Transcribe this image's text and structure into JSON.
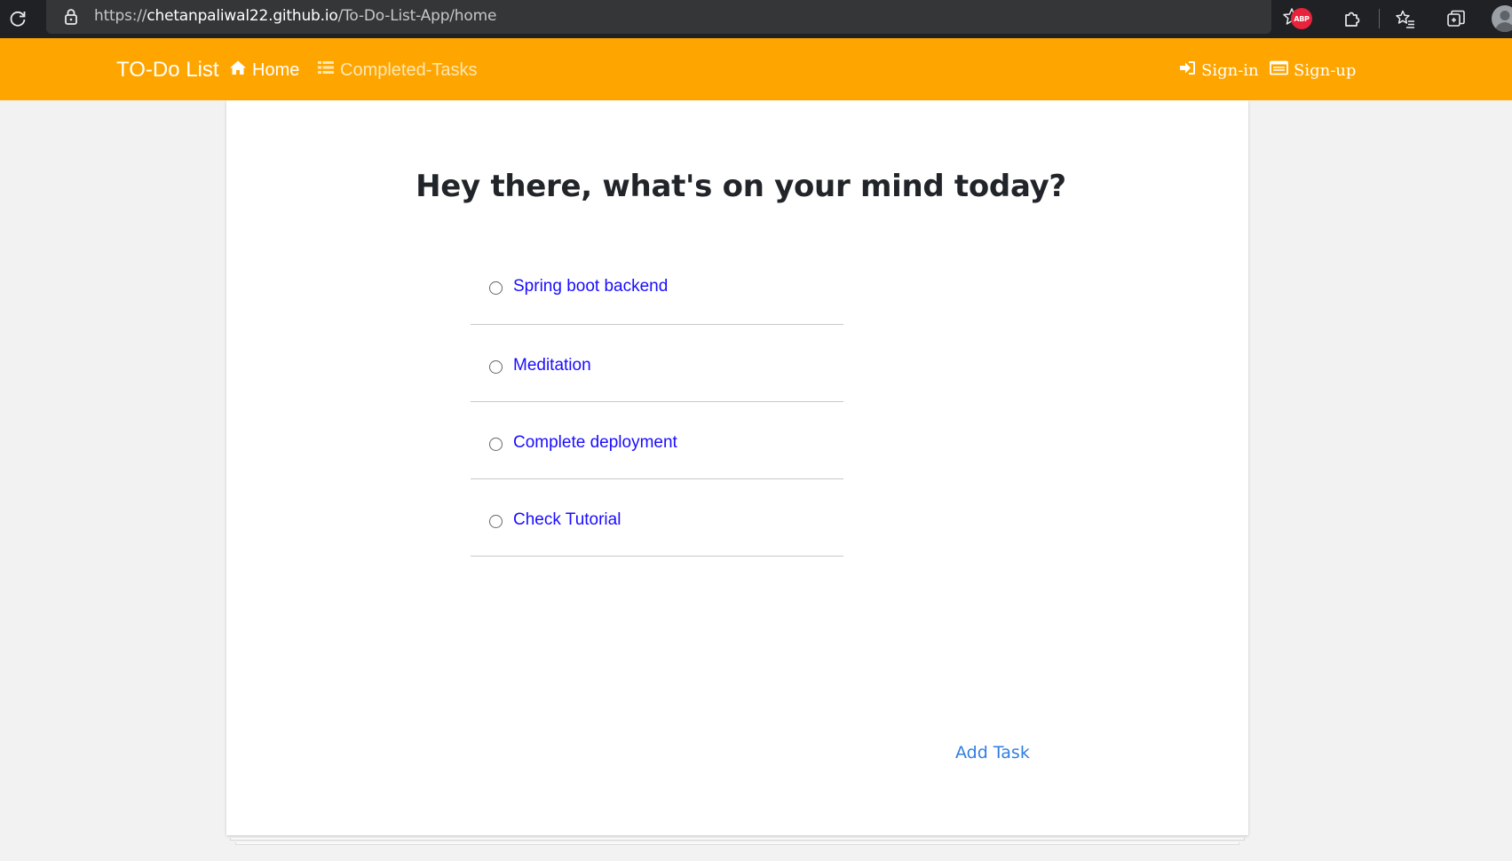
{
  "browser": {
    "url_scheme": "https://",
    "url_host": "chetanpaliwal22.github.io",
    "url_path": "/To-Do-List-App/home",
    "extension_abp_label": "ABP",
    "icons": [
      "reload-icon",
      "lock-icon",
      "star-add-icon",
      "abp-icon",
      "puzzle-icon",
      "favorites-icon",
      "collections-icon",
      "profile-icon"
    ]
  },
  "navbar": {
    "brand": "TO-Do List",
    "home_label": "Home",
    "completed_label": "Completed-Tasks",
    "signin_label": "Sign-in",
    "signup_label": "Sign-up",
    "background_color": "#ffa500"
  },
  "main": {
    "heading": "Hey there, what's on your mind today?",
    "tasks": [
      {
        "label": "Spring boot backend"
      },
      {
        "label": "Meditation"
      },
      {
        "label": "Complete deployment"
      },
      {
        "label": "Check Tutorial"
      }
    ],
    "add_task_label": "Add Task",
    "task_link_color": "#1a0dff",
    "add_task_color": "#2f7fe0"
  }
}
